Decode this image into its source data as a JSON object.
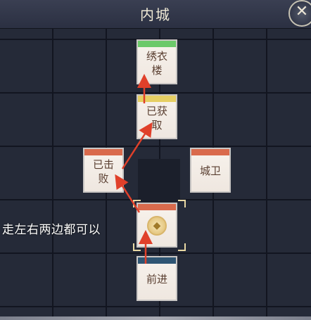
{
  "header": {
    "title": "内城",
    "close_glyph": "✕"
  },
  "nodes": [
    {
      "id": "xiuyilou",
      "label": "绣衣\n楼",
      "band_color": "#6cc96a"
    },
    {
      "id": "obtained",
      "label": "已获\n取",
      "band_color": "#e6cf63"
    },
    {
      "id": "defeated",
      "label": "已击\n败",
      "band_color": "#d96a4c"
    },
    {
      "id": "guard",
      "label": "城卫",
      "band_color": "#d96a4c"
    },
    {
      "id": "current",
      "label": "",
      "band_color": "#d96a4c",
      "icon": "coin-icon"
    },
    {
      "id": "advance",
      "label": "前进",
      "band_color": "#2f5573"
    }
  ],
  "annotation": "走左右两边都可以",
  "colors": {
    "arrow": "#e0402a",
    "background": "#252a38"
  }
}
